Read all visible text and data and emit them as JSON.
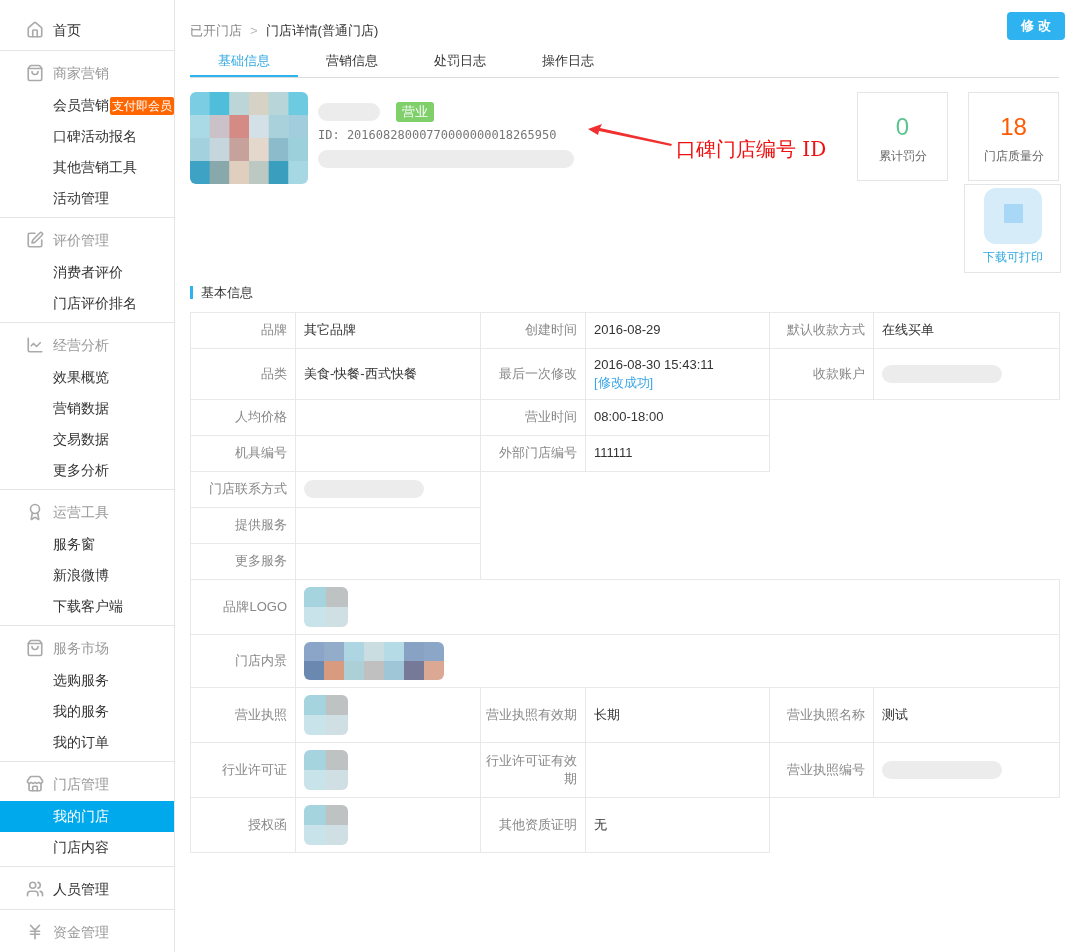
{
  "sidebar": {
    "groups": [
      {
        "kind": "link",
        "title": "首页"
      },
      {
        "kind": "group",
        "title": "商家营销",
        "items": [
          {
            "label": "会员营销",
            "badge": "支付即会员",
            "selected": false
          },
          {
            "label": "口碑活动报名",
            "selected": false
          },
          {
            "label": "其他营销工具",
            "selected": false
          },
          {
            "label": "活动管理",
            "selected": false
          }
        ]
      },
      {
        "kind": "group",
        "title": "评价管理",
        "items": [
          {
            "label": "消费者评价",
            "selected": false
          },
          {
            "label": "门店评价排名",
            "selected": false
          }
        ]
      },
      {
        "kind": "group",
        "title": "经营分析",
        "items": [
          {
            "label": "效果概览",
            "selected": false
          },
          {
            "label": "营销数据",
            "selected": false
          },
          {
            "label": "交易数据",
            "selected": false
          },
          {
            "label": "更多分析",
            "selected": false
          }
        ]
      },
      {
        "kind": "group",
        "title": "运营工具",
        "items": [
          {
            "label": "服务窗",
            "selected": false
          },
          {
            "label": "新浪微博",
            "selected": false
          },
          {
            "label": "下载客户端",
            "selected": false
          }
        ]
      },
      {
        "kind": "group",
        "title": "服务市场",
        "items": [
          {
            "label": "选购服务",
            "selected": false
          },
          {
            "label": "我的服务",
            "selected": false
          },
          {
            "label": "我的订单",
            "selected": false
          }
        ]
      },
      {
        "kind": "group",
        "title": "门店管理",
        "items": [
          {
            "label": "我的门店",
            "selected": true
          },
          {
            "label": "门店内容",
            "selected": false
          }
        ]
      },
      {
        "kind": "link",
        "title": "人员管理"
      },
      {
        "kind": "group",
        "title": "资金管理"
      }
    ]
  },
  "breadcrumb": {
    "parent": "已开门店",
    "separator": ">",
    "current": "门店详情(普通门店)"
  },
  "edit_button": "修 改",
  "tabs": [
    {
      "label": "基础信息",
      "selected": true
    },
    {
      "label": "营销信息",
      "selected": false
    },
    {
      "label": "处罚日志",
      "selected": false
    },
    {
      "label": "操作日志",
      "selected": false
    }
  ],
  "store": {
    "status": "营业",
    "id": "ID: 20160828000770000000018265950"
  },
  "annotation": "口碑门店编号 ID",
  "stats": [
    {
      "value": "0",
      "label": "累计罚分",
      "color": "#5cc58f"
    },
    {
      "value": "18",
      "label": "门店质量分",
      "color": "#ff5a00"
    }
  ],
  "qr_link": "下载可打印",
  "section_title": "基本信息",
  "table": {
    "rows": [
      {
        "cells": [
          {
            "label": "品牌",
            "kind": "text",
            "value": "其它品牌"
          },
          {
            "label": "创建时间",
            "kind": "text",
            "value": "2016-08-29"
          },
          {
            "label": "默认收款方式",
            "kind": "text",
            "value": "在线买单"
          }
        ]
      },
      {
        "cells": [
          {
            "label": "品类",
            "kind": "text",
            "value": "美食-快餐-西式快餐"
          },
          {
            "label": "最后一次修改",
            "kind": "text",
            "value": "2016-08-30 15:43:11",
            "link": "[修改成功]"
          },
          {
            "label": "收款账户",
            "kind": "redacted"
          }
        ]
      },
      {
        "cells": [
          {
            "label": "人均价格",
            "kind": "empty"
          },
          {
            "label": "营业时间",
            "kind": "text",
            "value": "08:00-18:00"
          }
        ]
      },
      {
        "cells": [
          {
            "label": "机具编号",
            "kind": "empty"
          },
          {
            "label": "外部门店编号",
            "kind": "text",
            "value": "111111"
          }
        ]
      },
      {
        "cells": [
          {
            "label": "门店联系方式",
            "kind": "redacted"
          }
        ]
      },
      {
        "cells": [
          {
            "label": "提供服务",
            "kind": "empty"
          }
        ]
      },
      {
        "cells": [
          {
            "label": "更多服务",
            "kind": "empty"
          }
        ]
      },
      {
        "cells": [
          {
            "label": "品牌LOGO"
          }
        ]
      },
      {
        "cells": [
          {
            "label": "门店内景",
            "kind": "gallery"
          }
        ]
      },
      {
        "cells": [
          {
            "label": "营业执照"
          },
          {
            "label": "营业执照有效期",
            "kind": "text",
            "value": "长期"
          },
          {
            "label": "营业执照名称",
            "kind": "text",
            "value": "测试"
          }
        ]
      },
      {
        "cells": [
          {
            "label": "行业许可证"
          },
          {
            "label": "行业许可证有效期",
            "kind": "empty"
          },
          {
            "label": "营业执照编号",
            "kind": "redacted"
          }
        ]
      },
      {
        "cells": [
          {
            "label": "授权函"
          },
          {
            "label": "其他资质证明",
            "kind": "text",
            "value": "无"
          }
        ]
      }
    ]
  }
}
